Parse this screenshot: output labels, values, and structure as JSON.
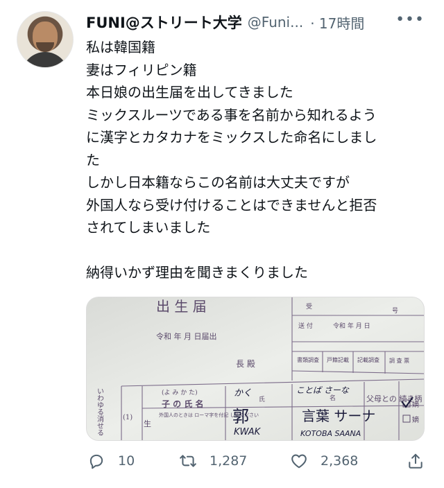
{
  "tweet": {
    "author_name": "FUNI@ストリート大学",
    "handle": "@Funi...",
    "time": "· 17時間",
    "more_label": "•••",
    "lines": [
      "私は韓国籍",
      "妻はフィリピン籍",
      "本日娘の出生届を出してきました",
      "ミックスルーツである事を名前から知れるよう",
      "に漢字とカタカナをミックスした命名にしまし",
      "た",
      "しかし日本籍ならこの名前は大丈夫ですが",
      "外国人なら受け付けることはできませんと拒否",
      "されてしまいました",
      "",
      "納得いかず理由を聞きまくりました"
    ]
  },
  "photo": {
    "form_title": "出  生  届",
    "era_line": "令和   年   月   日届出",
    "recipient": "長  殿",
    "received": "受",
    "sent": "送 付",
    "sent_date": "令和   年   月   日",
    "number_suffix": "号",
    "doc_check": "書類調査",
    "family_register": "戸籍記載",
    "record_check": "記載調査",
    "check_more": "調 査 票",
    "side_note": "いわゆる消せる",
    "row_number": "(1)",
    "born_label": "生",
    "furigana_label": "(よ み か た)",
    "child_name_label": "子 の 氏 名",
    "foreigner_note": "外国人のときは ローマ字を付記 してください",
    "surname_label": "氏",
    "given_label": "名",
    "surname_reading": "かく",
    "given_reading": "ことば さーな",
    "surname_kanji": "郭",
    "given_kanji": "言葉 サーナ",
    "surname_roman": "KWAK",
    "given_roman": "KOTOBA SAANA",
    "relation_label": "父母との 続き柄",
    "checkbox_a": "嫡",
    "checkbox_b": "嫡"
  },
  "actions": {
    "reply_count": "10",
    "retweet_count": "1,287",
    "like_count": "2,368"
  },
  "colors": {
    "text": "#0f1419",
    "muted": "#536471",
    "form_line": "#7a6a88",
    "ink": "#1a1a3a"
  }
}
